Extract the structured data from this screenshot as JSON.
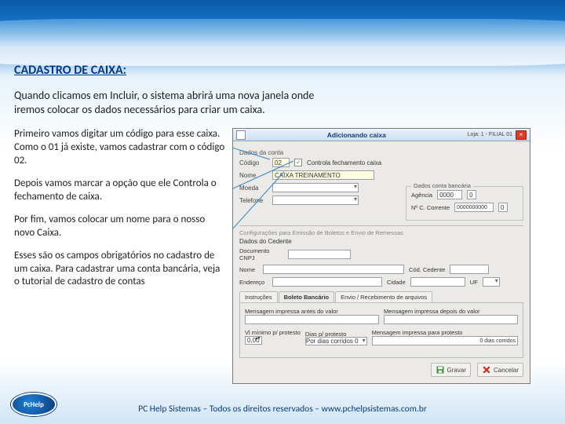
{
  "page": {
    "title": "CADASTRO DE CAIXA:",
    "intro": "Quando clicamos em Incluir, o sistema abrirá uma nova janela onde iremos colocar os dados necessários para criar um caixa.",
    "p1": "Primeiro vamos digitar um código para esse caixa. Como o 01 já existe, vamos cadastrar com o código 02.",
    "p2": "Depois vamos marcar a opção que ele Controla o fechamento de caixa.",
    "p3": "Por fim, vamos colocar um nome para o nosso novo Caixa.",
    "p4": "Esses são os campos obrigatórios no cadastro de um caixa. Para cadastrar uma conta bancária, veja o tutorial de cadastro de contas"
  },
  "window": {
    "title": "Adicionando caixa",
    "loja": "Loja: 1 - FILIAL 01",
    "section_top": "Dados da conta",
    "codigo_label": "Código",
    "codigo_value": "02",
    "checkbox_label": "Controla fechamento caixa",
    "nome_label": "Nome",
    "nome_value": "CAIXA TREINAMENTO",
    "moeda_label": "Moeda",
    "telefone_label": "Telefone",
    "bank_group": "Dados conta bancária",
    "agencia_label": "Agência",
    "agencia_v1": "0000",
    "agencia_v2": "0",
    "conta_label": "Nº C. Corrente",
    "conta_v1": "0000000000",
    "conta_v2": "0",
    "boleto_group": "Configurações para Emissão de Boletos e Envio de Remessas",
    "cedente_tab": "Dados do Cedente",
    "cnpj_label": "Documento CNPJ",
    "nome_cedente_label": "Nome",
    "codc_label": "Cód. Cedente",
    "end_label": "Endereço",
    "cidade_label": "Cidade",
    "uf_label": "UF",
    "tabs": {
      "t1": "Instruções",
      "t2": "Boleto Bancário",
      "t3": "Envio / Recebimento de arquivos"
    },
    "msg_antes": "Mensagem impressa antes do valor",
    "msg_depois": "Mensagem impressa depois do valor",
    "vmin_label": "Vl mínimo p/ protesto",
    "dias_label": "Dias p/ protesto",
    "vmin_value": "0,00",
    "dias_opt": "Por dias corridos 0",
    "msg_prot": "Mensagem impressa para protesto",
    "dias_corridos_value": "0 dias corridos",
    "btn_save": "Gravar",
    "btn_cancel": "Cancelar"
  },
  "footer": "PC Help Sistemas – Todos os direitos reservados – www.pchelpsistemas.com.br",
  "logo_text": "PcHelp"
}
